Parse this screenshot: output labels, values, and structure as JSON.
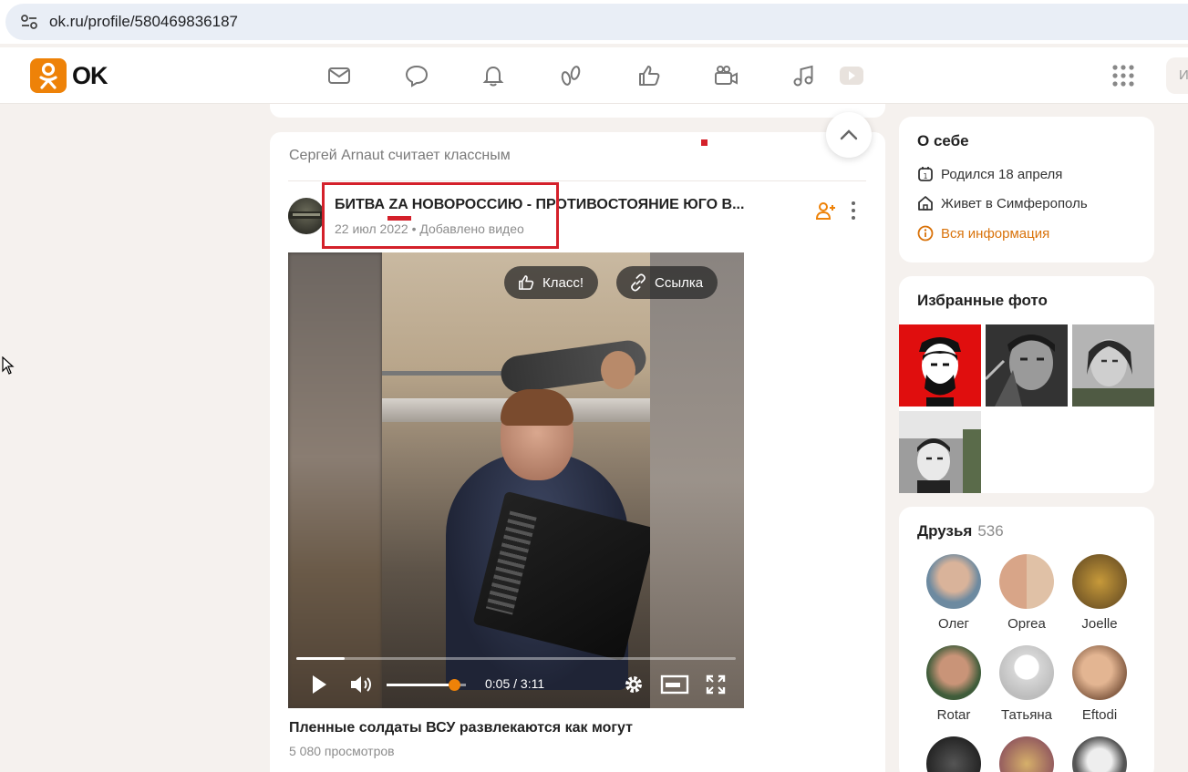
{
  "browser": {
    "url": "ok.ru/profile/580469836187"
  },
  "header": {
    "logo_text": "OK",
    "nav_icons": [
      "mail-icon",
      "chat-icon",
      "bell-icon",
      "guests-icon",
      "like-icon",
      "video-camera-icon",
      "music-icon",
      "video-play-icon"
    ],
    "search_placeholder": "И"
  },
  "feed": {
    "liked_by": "Сергей Arnaut считает классным",
    "post": {
      "title": "БИТВА ZA НОВОРОССИЮ - ПРОТИВОСТОЯНИЕ ЮГО В...",
      "date": "22 июл 2022",
      "separator": " • ",
      "action": "Добавлено видео"
    },
    "video": {
      "like_button": "Класс!",
      "link_button": "Ссылка",
      "time": "0:05 / 3:11",
      "progress_fraction": 0.11,
      "volume_fraction": 0.85,
      "title": "Пленные солдаты ВСУ развлекаются как могут",
      "views": "5 080 просмотров"
    }
  },
  "about": {
    "title": "О себе",
    "born": "Родился 18 апреля",
    "lives": "Живет в Симферополь",
    "all_info": "Вся информация"
  },
  "photos": {
    "title": "Избранные фото"
  },
  "friends": {
    "title": "Друзья",
    "count": "536",
    "items": [
      {
        "name": "Олег"
      },
      {
        "name": "Oprea"
      },
      {
        "name": "Joelle"
      },
      {
        "name": "Rotar"
      },
      {
        "name": "Татьяна"
      },
      {
        "name": "Eftodi"
      }
    ]
  },
  "colors": {
    "accent": "#ee8208",
    "highlight_red": "#d4202a",
    "link_orange": "#d9730b"
  }
}
